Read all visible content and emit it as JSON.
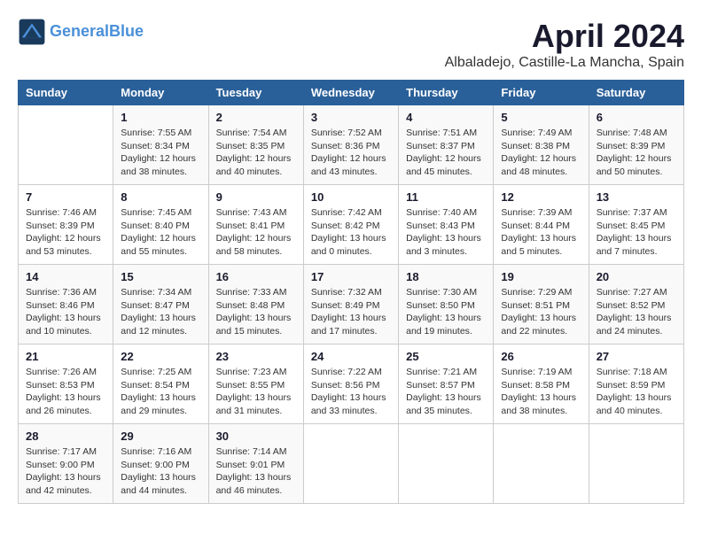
{
  "header": {
    "logo_line1": "General",
    "logo_line2": "Blue",
    "month": "April 2024",
    "location": "Albaladejo, Castille-La Mancha, Spain"
  },
  "weekdays": [
    "Sunday",
    "Monday",
    "Tuesday",
    "Wednesday",
    "Thursday",
    "Friday",
    "Saturday"
  ],
  "weeks": [
    [
      {
        "day": "",
        "info": ""
      },
      {
        "day": "1",
        "info": "Sunrise: 7:55 AM\nSunset: 8:34 PM\nDaylight: 12 hours\nand 38 minutes."
      },
      {
        "day": "2",
        "info": "Sunrise: 7:54 AM\nSunset: 8:35 PM\nDaylight: 12 hours\nand 40 minutes."
      },
      {
        "day": "3",
        "info": "Sunrise: 7:52 AM\nSunset: 8:36 PM\nDaylight: 12 hours\nand 43 minutes."
      },
      {
        "day": "4",
        "info": "Sunrise: 7:51 AM\nSunset: 8:37 PM\nDaylight: 12 hours\nand 45 minutes."
      },
      {
        "day": "5",
        "info": "Sunrise: 7:49 AM\nSunset: 8:38 PM\nDaylight: 12 hours\nand 48 minutes."
      },
      {
        "day": "6",
        "info": "Sunrise: 7:48 AM\nSunset: 8:39 PM\nDaylight: 12 hours\nand 50 minutes."
      }
    ],
    [
      {
        "day": "7",
        "info": "Sunrise: 7:46 AM\nSunset: 8:39 PM\nDaylight: 12 hours\nand 53 minutes."
      },
      {
        "day": "8",
        "info": "Sunrise: 7:45 AM\nSunset: 8:40 PM\nDaylight: 12 hours\nand 55 minutes."
      },
      {
        "day": "9",
        "info": "Sunrise: 7:43 AM\nSunset: 8:41 PM\nDaylight: 12 hours\nand 58 minutes."
      },
      {
        "day": "10",
        "info": "Sunrise: 7:42 AM\nSunset: 8:42 PM\nDaylight: 13 hours\nand 0 minutes."
      },
      {
        "day": "11",
        "info": "Sunrise: 7:40 AM\nSunset: 8:43 PM\nDaylight: 13 hours\nand 3 minutes."
      },
      {
        "day": "12",
        "info": "Sunrise: 7:39 AM\nSunset: 8:44 PM\nDaylight: 13 hours\nand 5 minutes."
      },
      {
        "day": "13",
        "info": "Sunrise: 7:37 AM\nSunset: 8:45 PM\nDaylight: 13 hours\nand 7 minutes."
      }
    ],
    [
      {
        "day": "14",
        "info": "Sunrise: 7:36 AM\nSunset: 8:46 PM\nDaylight: 13 hours\nand 10 minutes."
      },
      {
        "day": "15",
        "info": "Sunrise: 7:34 AM\nSunset: 8:47 PM\nDaylight: 13 hours\nand 12 minutes."
      },
      {
        "day": "16",
        "info": "Sunrise: 7:33 AM\nSunset: 8:48 PM\nDaylight: 13 hours\nand 15 minutes."
      },
      {
        "day": "17",
        "info": "Sunrise: 7:32 AM\nSunset: 8:49 PM\nDaylight: 13 hours\nand 17 minutes."
      },
      {
        "day": "18",
        "info": "Sunrise: 7:30 AM\nSunset: 8:50 PM\nDaylight: 13 hours\nand 19 minutes."
      },
      {
        "day": "19",
        "info": "Sunrise: 7:29 AM\nSunset: 8:51 PM\nDaylight: 13 hours\nand 22 minutes."
      },
      {
        "day": "20",
        "info": "Sunrise: 7:27 AM\nSunset: 8:52 PM\nDaylight: 13 hours\nand 24 minutes."
      }
    ],
    [
      {
        "day": "21",
        "info": "Sunrise: 7:26 AM\nSunset: 8:53 PM\nDaylight: 13 hours\nand 26 minutes."
      },
      {
        "day": "22",
        "info": "Sunrise: 7:25 AM\nSunset: 8:54 PM\nDaylight: 13 hours\nand 29 minutes."
      },
      {
        "day": "23",
        "info": "Sunrise: 7:23 AM\nSunset: 8:55 PM\nDaylight: 13 hours\nand 31 minutes."
      },
      {
        "day": "24",
        "info": "Sunrise: 7:22 AM\nSunset: 8:56 PM\nDaylight: 13 hours\nand 33 minutes."
      },
      {
        "day": "25",
        "info": "Sunrise: 7:21 AM\nSunset: 8:57 PM\nDaylight: 13 hours\nand 35 minutes."
      },
      {
        "day": "26",
        "info": "Sunrise: 7:19 AM\nSunset: 8:58 PM\nDaylight: 13 hours\nand 38 minutes."
      },
      {
        "day": "27",
        "info": "Sunrise: 7:18 AM\nSunset: 8:59 PM\nDaylight: 13 hours\nand 40 minutes."
      }
    ],
    [
      {
        "day": "28",
        "info": "Sunrise: 7:17 AM\nSunset: 9:00 PM\nDaylight: 13 hours\nand 42 minutes."
      },
      {
        "day": "29",
        "info": "Sunrise: 7:16 AM\nSunset: 9:00 PM\nDaylight: 13 hours\nand 44 minutes."
      },
      {
        "day": "30",
        "info": "Sunrise: 7:14 AM\nSunset: 9:01 PM\nDaylight: 13 hours\nand 46 minutes."
      },
      {
        "day": "",
        "info": ""
      },
      {
        "day": "",
        "info": ""
      },
      {
        "day": "",
        "info": ""
      },
      {
        "day": "",
        "info": ""
      }
    ]
  ]
}
